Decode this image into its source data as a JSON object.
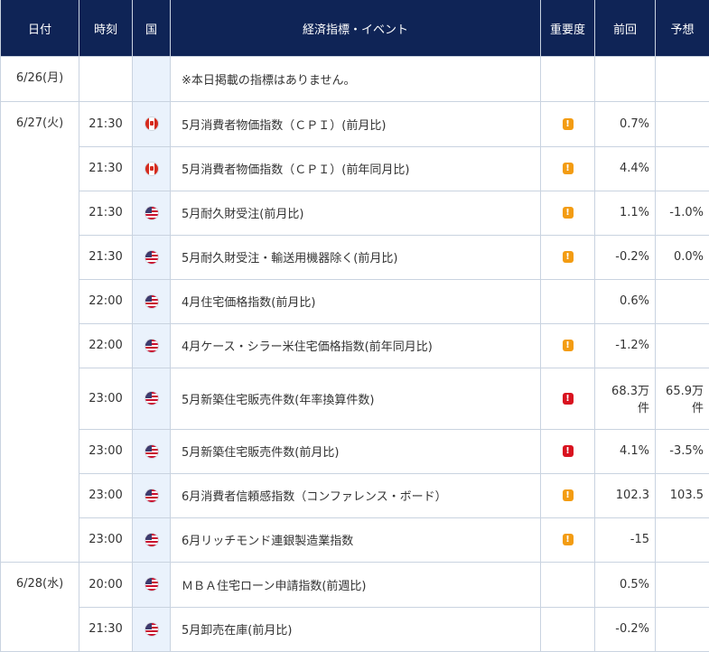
{
  "headers": {
    "date": "日付",
    "time": "時刻",
    "country": "国",
    "event": "経済指標・イベント",
    "importance": "重要度",
    "previous": "前回",
    "forecast": "予想"
  },
  "colors": {
    "header_bg": "#0f2456",
    "country_bg": "#eaf2fc",
    "mid_importance": "#f39c12",
    "high_importance": "#d9121f"
  },
  "rows": [
    {
      "date": "6/26(月)",
      "time": "",
      "flag": "",
      "event": "※本日掲載の指標はありません。",
      "importance": "",
      "previous": "",
      "forecast": ""
    },
    {
      "date": "6/27(火)",
      "time": "21:30",
      "flag": "ca-flag-icon",
      "event": "5月消費者物価指数（ＣＰＩ）(前月比)",
      "importance": "mid",
      "previous": "0.7%",
      "forecast": ""
    },
    {
      "date": "",
      "time": "21:30",
      "flag": "ca-flag-icon",
      "event": "5月消費者物価指数（ＣＰＩ）(前年同月比)",
      "importance": "mid",
      "previous": "4.4%",
      "forecast": ""
    },
    {
      "date": "",
      "time": "21:30",
      "flag": "us-flag-icon",
      "event": "5月耐久財受注(前月比)",
      "importance": "mid",
      "previous": "1.1%",
      "forecast": "-1.0%"
    },
    {
      "date": "",
      "time": "21:30",
      "flag": "us-flag-icon",
      "event": "5月耐久財受注・輸送用機器除く(前月比)",
      "importance": "mid",
      "previous": "-0.2%",
      "forecast": "0.0%"
    },
    {
      "date": "",
      "time": "22:00",
      "flag": "us-flag-icon",
      "event": "4月住宅価格指数(前月比)",
      "importance": "",
      "previous": "0.6%",
      "forecast": ""
    },
    {
      "date": "",
      "time": "22:00",
      "flag": "us-flag-icon",
      "event": "4月ケース・シラー米住宅価格指数(前年同月比)",
      "importance": "mid",
      "previous": "-1.2%",
      "forecast": ""
    },
    {
      "date": "",
      "time": "23:00",
      "flag": "us-flag-icon",
      "event": "5月新築住宅販売件数(年率換算件数)",
      "importance": "high",
      "previous": "68.3万件",
      "forecast": "65.9万件"
    },
    {
      "date": "",
      "time": "23:00",
      "flag": "us-flag-icon",
      "event": "5月新築住宅販売件数(前月比)",
      "importance": "high",
      "previous": "4.1%",
      "forecast": "-3.5%"
    },
    {
      "date": "",
      "time": "23:00",
      "flag": "us-flag-icon",
      "event": "6月消費者信頼感指数（コンファレンス・ボード）",
      "importance": "mid",
      "previous": "102.3",
      "forecast": "103.5"
    },
    {
      "date": "",
      "time": "23:00",
      "flag": "us-flag-icon",
      "event": "6月リッチモンド連銀製造業指数",
      "importance": "mid",
      "previous": "-15",
      "forecast": ""
    },
    {
      "date": "6/28(水)",
      "time": "20:00",
      "flag": "us-flag-icon",
      "event": "ＭＢＡ住宅ローン申請指数(前週比)",
      "importance": "",
      "previous": "0.5%",
      "forecast": ""
    },
    {
      "date": "",
      "time": "21:30",
      "flag": "us-flag-icon",
      "event": "5月卸売在庫(前月比)",
      "importance": "",
      "previous": "-0.2%",
      "forecast": ""
    }
  ]
}
